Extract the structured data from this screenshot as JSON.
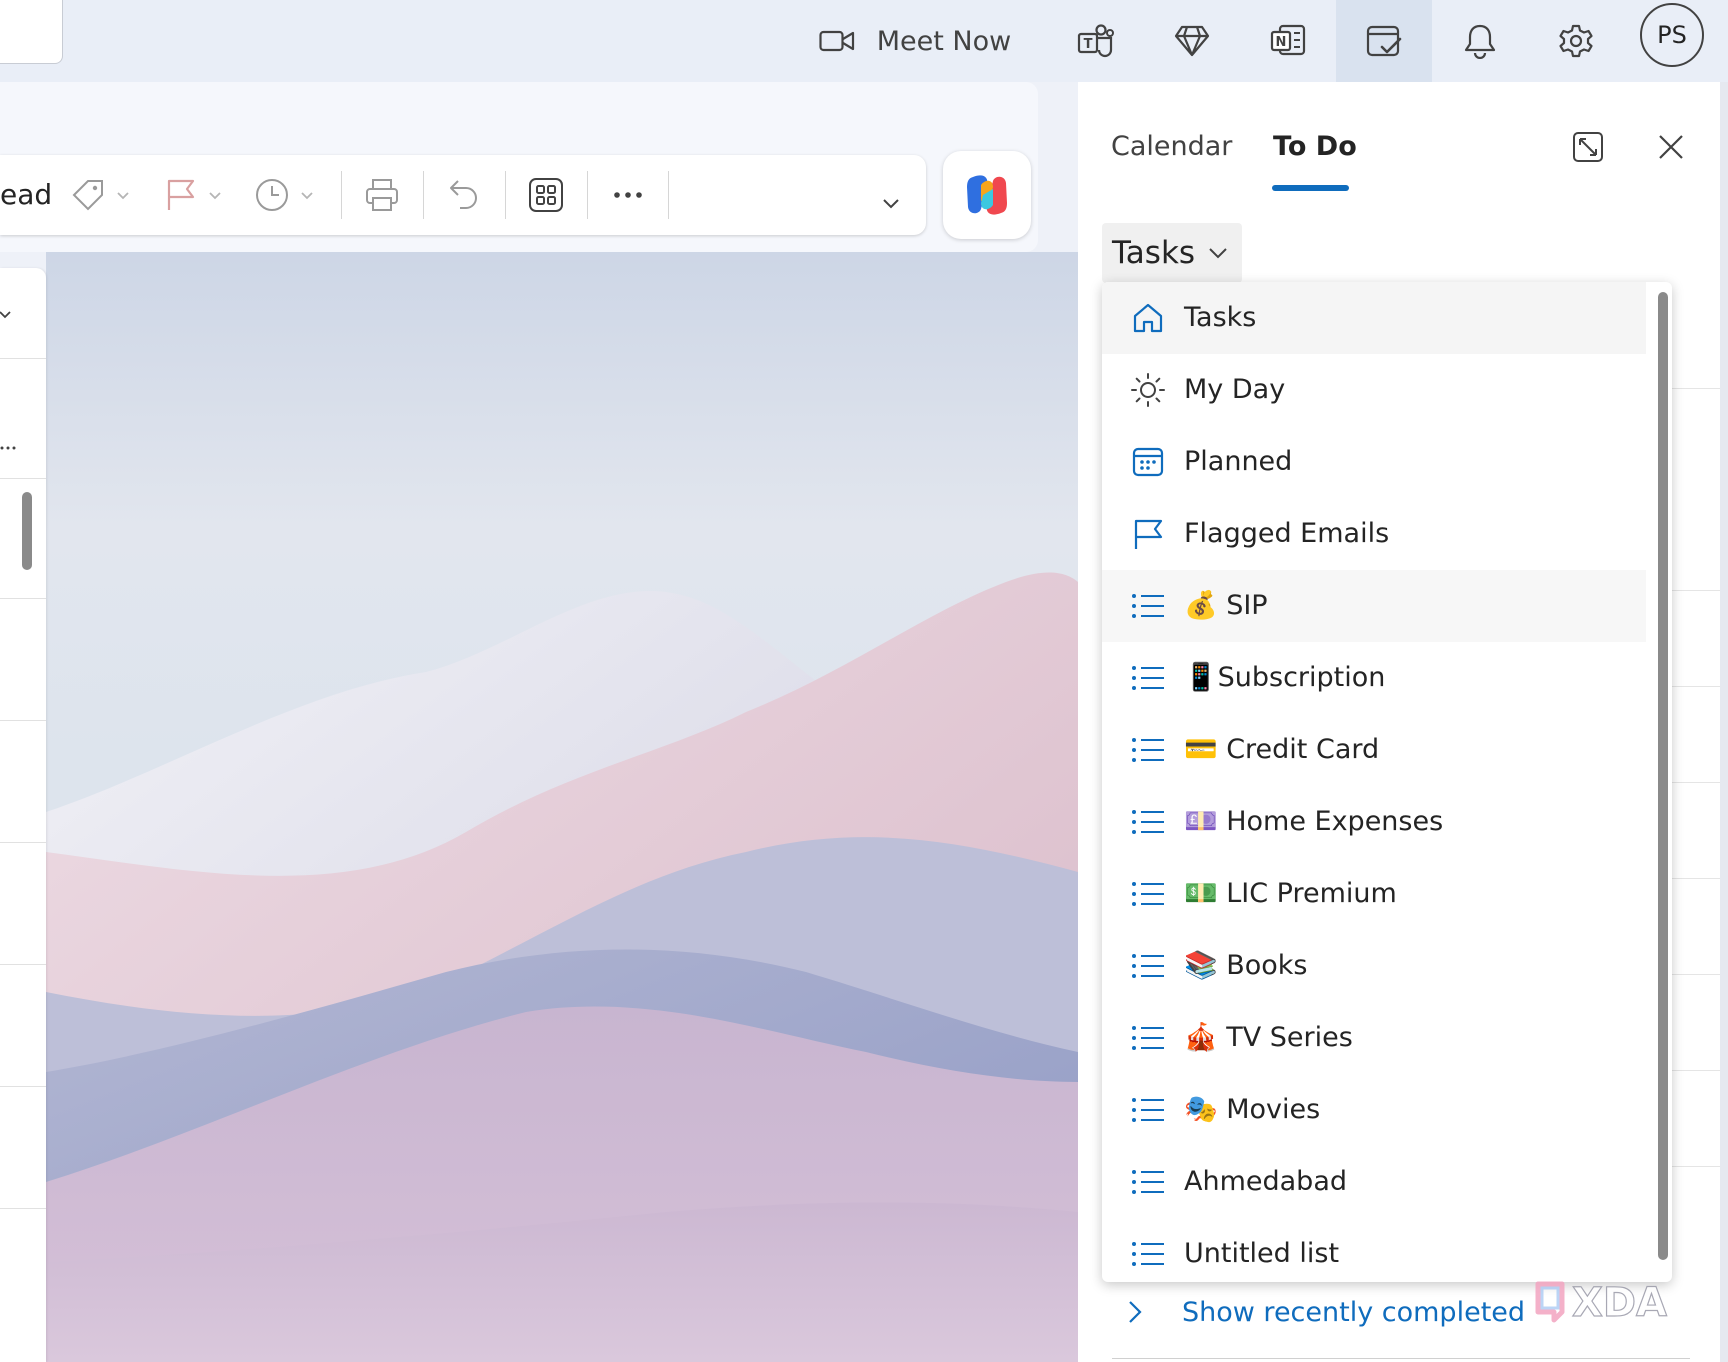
{
  "topbar": {
    "meet_now_label": "Meet Now",
    "avatar_initials": "PS"
  },
  "toolbar": {
    "read_label": "ead"
  },
  "todo_pane": {
    "tabs": [
      {
        "label": "Calendar"
      },
      {
        "label": "To Do"
      }
    ],
    "active_tab": "To Do",
    "list_picker_label": "Tasks",
    "lists": [
      {
        "label": "Tasks",
        "icon": "home-icon"
      },
      {
        "label": "My Day",
        "icon": "sun-icon"
      },
      {
        "label": "Planned",
        "icon": "calendar-icon"
      },
      {
        "label": "Flagged Emails",
        "icon": "flag-icon"
      },
      {
        "label": "💰 SIP",
        "icon": "list-icon"
      },
      {
        "label": "📱Subscription",
        "icon": "list-icon"
      },
      {
        "label": "💳 Credit Card",
        "icon": "list-icon"
      },
      {
        "label": "💷 Home Expenses",
        "icon": "list-icon"
      },
      {
        "label": "💵 LIC Premium",
        "icon": "list-icon"
      },
      {
        "label": "📚 Books",
        "icon": "list-icon"
      },
      {
        "label": "🎪 TV Series",
        "icon": "list-icon"
      },
      {
        "label": "🎭 Movies",
        "icon": "list-icon"
      },
      {
        "label": "Ahmedabad",
        "icon": "list-icon"
      },
      {
        "label": "Untitled list",
        "icon": "list-icon"
      }
    ],
    "show_completed_label": "Show recently completed"
  },
  "watermark": "XDA",
  "colors": {
    "accent": "#0f6cbd",
    "topbar_bg": "#e9eef7"
  }
}
